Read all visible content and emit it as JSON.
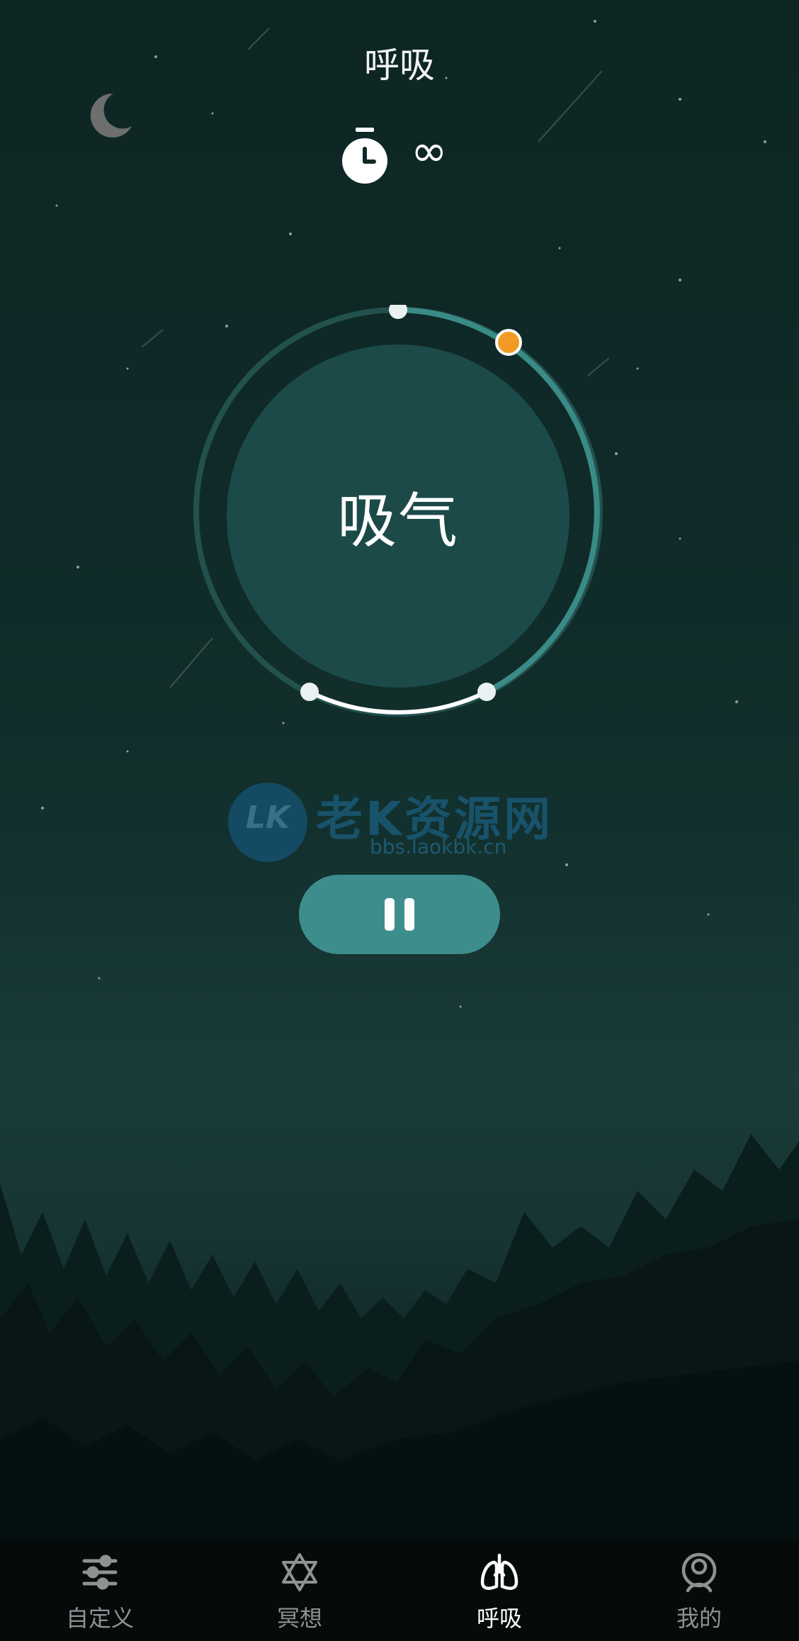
{
  "header": {
    "title": "呼吸",
    "duration": "∞"
  },
  "breath": {
    "phase_label": "吸气"
  },
  "watermark": {
    "badge": "LK",
    "brand": "老K资源网",
    "url": "bbs.laokbk.cn"
  },
  "nav": {
    "items": [
      {
        "label": "自定义",
        "icon": "sliders-icon",
        "active": false
      },
      {
        "label": "冥想",
        "icon": "star-of-david-icon",
        "active": false
      },
      {
        "label": "呼吸",
        "icon": "lungs-icon",
        "active": true
      },
      {
        "label": "我的",
        "icon": "user-icon",
        "active": false
      }
    ]
  },
  "colors": {
    "background": "#0f2a28",
    "ring": "#3a8a87",
    "core": "#1c4a48",
    "accent_dot": "#f39a26",
    "button": "#3e8d8d",
    "nav_bg": "#050b0b"
  }
}
